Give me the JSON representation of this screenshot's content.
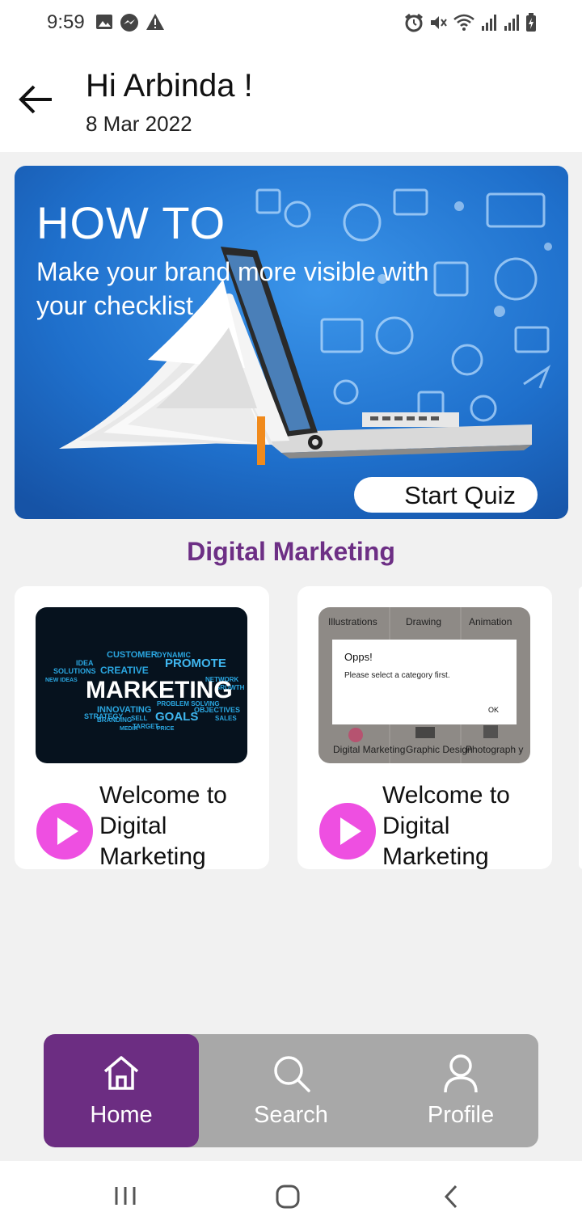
{
  "status_bar": {
    "time": "9:59",
    "icons_left": [
      "image-icon",
      "messenger-icon",
      "warning-icon"
    ],
    "icons_right": [
      "alarm-icon",
      "mute-icon",
      "wifi-icon",
      "signal-icon",
      "signal-icon",
      "battery-icon"
    ]
  },
  "header": {
    "greeting": "Hi Arbinda !",
    "date": "8 Mar 2022"
  },
  "hero": {
    "title": "HOW TO",
    "subtitle": "Make your brand more visible with your checklist",
    "button_label": "Start Quiz"
  },
  "section": {
    "title": "Digital Marketing"
  },
  "cards": [
    {
      "title": "Welcome to Digital Marketing",
      "thumb_text": {
        "main": "MARKETING",
        "words": [
          "CUSTOMER",
          "PROMOTE",
          "CREATIVE",
          "IDEA",
          "SOLUTIONS",
          "STRATEGY",
          "INNOVATING",
          "GOALS",
          "TARGET",
          "OBJECTIVES",
          "SALES",
          "DYNAMIC",
          "NEW IDEAS",
          "BRANDING",
          "PRICE",
          "GROWTH",
          "NETWORK",
          "PROBLEM SOLVING",
          "SELL",
          "MEDIA"
        ]
      }
    },
    {
      "title": "Welcome to Digital Marketing",
      "thumb_text": {
        "top_labels": [
          "Illustrations",
          "Drawing",
          "Animation"
        ],
        "bottom_labels": [
          "Digital Marketing",
          "Graphic Design",
          "Photograph y"
        ],
        "dialog_title": "Opps!",
        "dialog_message": "Please select a category first.",
        "dialog_button": "OK"
      }
    }
  ],
  "bottom_nav": {
    "items": [
      {
        "label": "Home",
        "icon": "home-icon",
        "active": true
      },
      {
        "label": "Search",
        "icon": "search-icon",
        "active": false
      },
      {
        "label": "Profile",
        "icon": "person-icon",
        "active": false
      }
    ],
    "active_color": "#6c2d82",
    "inactive_color": "#a8a8a8"
  },
  "colors": {
    "section_title": "#6d2f85",
    "play_button": "#ee4fe1",
    "hero_blue": "#1e73cf"
  }
}
